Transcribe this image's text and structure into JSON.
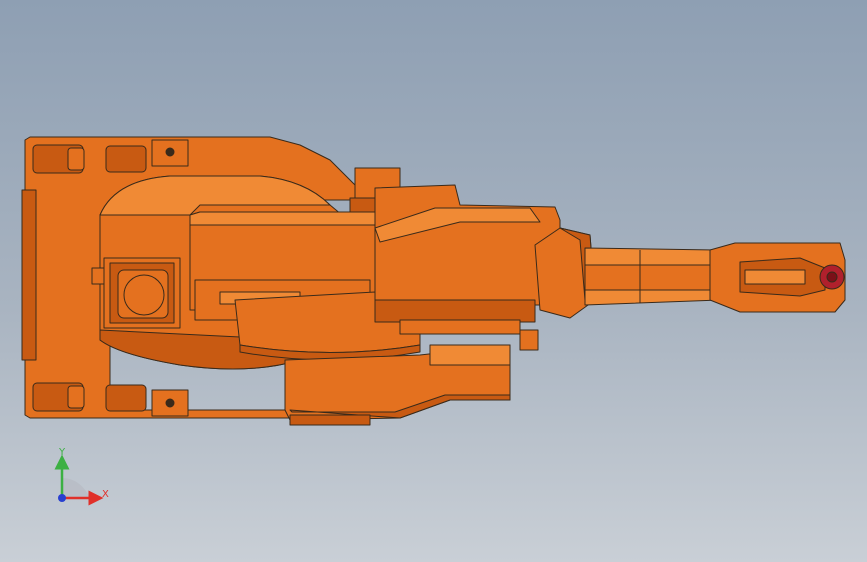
{
  "viewport": {
    "background_top": "#8e9fb3",
    "background_bottom": "#c9cfd6",
    "model_color": "#e4711f",
    "model_shade": "#c85a12",
    "model_highlight": "#f08a35",
    "edge_color": "#3a2a1a",
    "tool_tip_color": "#b0202c"
  },
  "triad": {
    "x_label": "X",
    "y_label": "Y",
    "x_color": "#e0302a",
    "y_color": "#3cb043",
    "z_color": "#2840d0"
  }
}
